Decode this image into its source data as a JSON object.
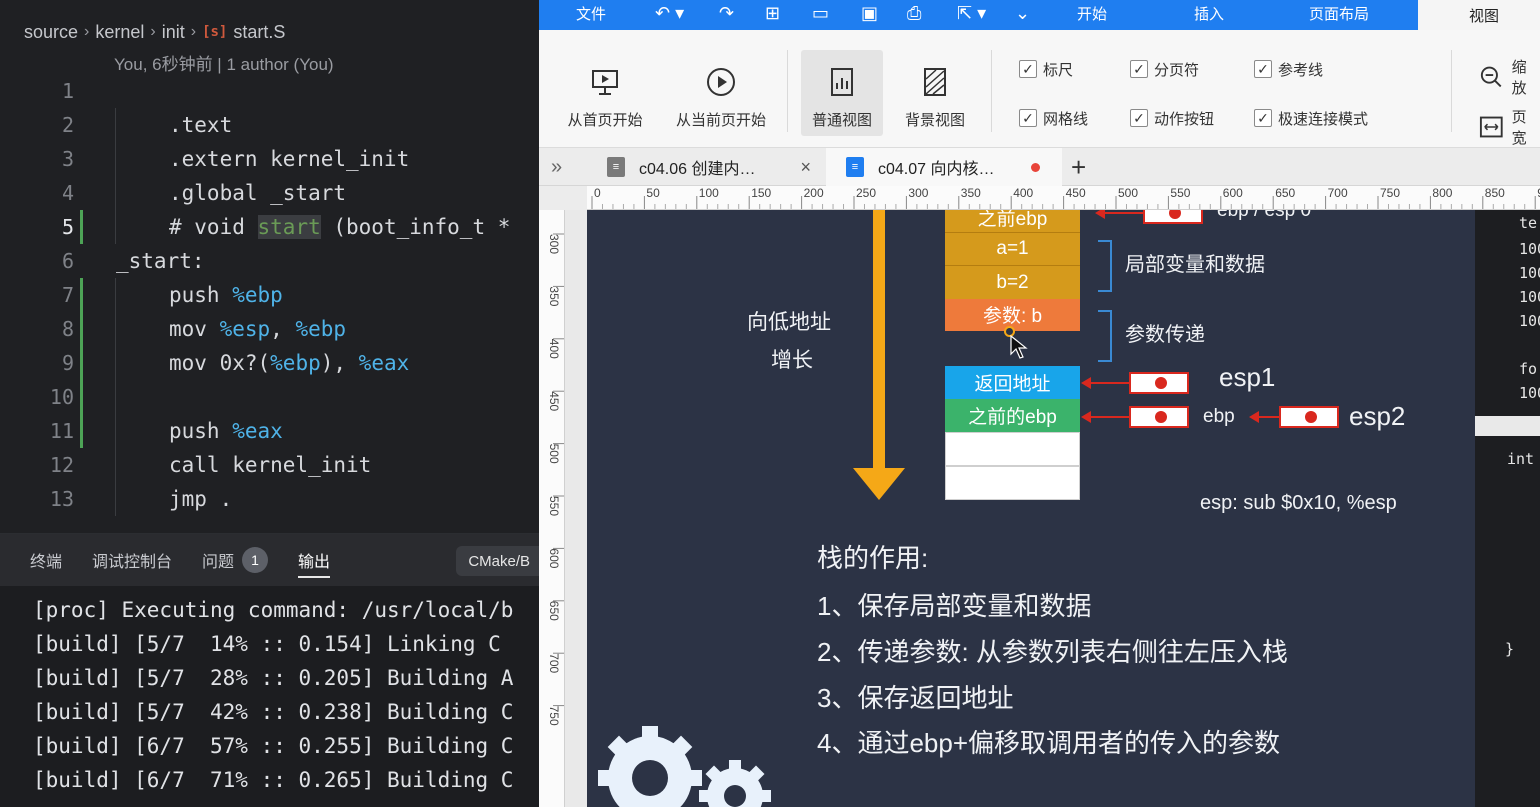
{
  "editor": {
    "breadcrumb": [
      "source",
      "kernel",
      "init",
      "start.S"
    ],
    "asm_icon": "[s]",
    "blame": "You, 6秒钟前 | 1 author (You)",
    "lines": [
      {
        "n": "1",
        "code": ""
      },
      {
        "n": "2",
        "code": ".text"
      },
      {
        "n": "3",
        "code": ".extern kernel_init"
      },
      {
        "n": "4",
        "code": ".global _start"
      },
      {
        "n": "5",
        "code": "# void start (boot_info_t *"
      },
      {
        "n": "6",
        "code": "_start:"
      },
      {
        "n": "7",
        "code": "push %ebp"
      },
      {
        "n": "8",
        "code": "mov %esp, %ebp"
      },
      {
        "n": "9",
        "code": "mov 0x?(%ebp), %eax"
      },
      {
        "n": "10",
        "code": ""
      },
      {
        "n": "11",
        "code": "push %eax"
      },
      {
        "n": "12",
        "code": "call kernel_init"
      },
      {
        "n": "13",
        "code": "jmp ."
      }
    ]
  },
  "panel": {
    "tabs": [
      "终端",
      "调试控制台",
      "问题",
      "输出"
    ],
    "problems_count": "1",
    "cmake_tab": "CMake/B",
    "output": [
      "[proc] Executing command: /usr/local/b",
      "[build] [5/7  14% :: 0.154] Linking C",
      "[build] [5/7  28% :: 0.205] Building A",
      "[build] [5/7  42% :: 0.238] Building C",
      "[build] [6/7  57% :: 0.255] Building C",
      "[build] [6/7  71% :: 0.265] Building C"
    ]
  },
  "ppt": {
    "menu": {
      "file": "文件",
      "start": "开始",
      "insert": "插入",
      "page_layout": "页面布局",
      "view": "视图"
    },
    "ribbon": {
      "from_first": "从首页开始",
      "from_current": "从当前页开始",
      "normal_view": "普通视图",
      "background_view": "背景视图",
      "checkboxes": [
        "标尺",
        "分页符",
        "参考线",
        "网格线",
        "动作按钮",
        "极速连接模式"
      ],
      "zoom": "缩放",
      "page_width": "页宽"
    },
    "tabs": [
      {
        "label": "c04.06 创建内…",
        "close": "×"
      },
      {
        "label": "c04.07 向内核…"
      }
    ],
    "ruler_h": [
      "0",
      "50",
      "100",
      "150",
      "200",
      "250",
      "300",
      "350",
      "400",
      "450",
      "500",
      "550",
      "600",
      "650",
      "700",
      "750",
      "800",
      "850",
      "9"
    ],
    "ruler_v": [
      "300",
      "350",
      "400",
      "450",
      "500",
      "550",
      "600",
      "650",
      "700",
      "750"
    ],
    "slide": {
      "stack_cells": [
        "之前ebp",
        "a=1",
        "b=2",
        "参数: b",
        "返回地址",
        "之前的ebp",
        "",
        ""
      ],
      "top_label": "ebp / esp 0",
      "arrow_label_1": "向低地址",
      "arrow_label_2": "增长",
      "local_label": "局部变量和数据",
      "param_label": "参数传递",
      "esp1": "esp1",
      "ebp": "ebp",
      "esp2": "esp2",
      "esp_note": "esp: sub $0x10, %esp",
      "heading": "栈的作用:",
      "points": [
        "1、保存局部变量和数据",
        "2、传递参数: 从参数列表右侧往左压入栈",
        "3、保存返回地址",
        "4、通过ebp+偏移取调用者的传入的参数"
      ]
    },
    "peek": [
      "te",
      "100",
      "100",
      "100",
      "100",
      "fo",
      "100",
      "int",
      "}"
    ]
  },
  "colors": {
    "menubar": "#1f7ef0",
    "slide_bg": "#2c3345",
    "arrow": "#f5a817",
    "pointer": "#d9281e"
  }
}
